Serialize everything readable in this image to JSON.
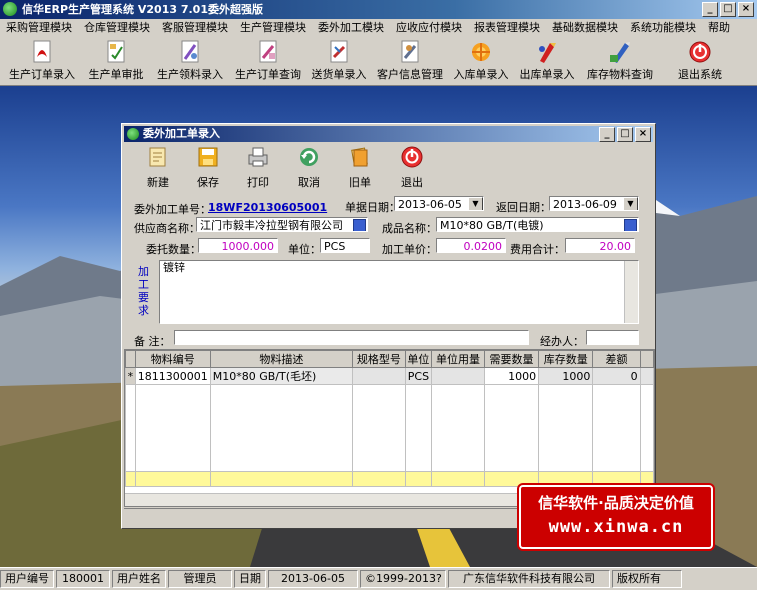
{
  "app": {
    "title": "信华ERP生产管理系统  V2013  7.01委外超强版"
  },
  "menu": [
    "采购管理模块",
    "仓库管理模块",
    "客服管理模块",
    "生产管理模块",
    "委外加工模块",
    "应收应付模块",
    "报表管理模块",
    "基础数据模块",
    "系统功能模块",
    "帮助"
  ],
  "toolbar": [
    {
      "label": "生产订单录入",
      "icon": "pdf-doc-icon"
    },
    {
      "label": "生产单审批",
      "icon": "approve-doc-icon"
    },
    {
      "label": "生产领料录入",
      "icon": "material-doc-icon"
    },
    {
      "label": "生产订单查询",
      "icon": "query-doc-icon"
    },
    {
      "label": "送货单录入",
      "icon": "delivery-doc-icon"
    },
    {
      "label": "客户信息管理",
      "icon": "customer-doc-icon"
    },
    {
      "label": "入库单录入",
      "icon": "stock-in-icon"
    },
    {
      "label": "出库单录入",
      "icon": "stock-out-icon"
    },
    {
      "label": "库存物料查询",
      "icon": "inventory-icon"
    },
    {
      "label": "退出系统",
      "icon": "power-icon"
    }
  ],
  "child": {
    "title": "委外加工单录入",
    "buttons": [
      {
        "label": "新建",
        "icon": "new-doc-icon"
      },
      {
        "label": "保存",
        "icon": "floppy-icon"
      },
      {
        "label": "打印",
        "icon": "printer-icon"
      },
      {
        "label": "取消",
        "icon": "undo-icon"
      },
      {
        "label": "旧单",
        "icon": "old-docs-icon"
      },
      {
        "label": "退出",
        "icon": "power-icon"
      }
    ],
    "form": {
      "order_no_label": "委外加工单号：",
      "order_no": "18WF20130605001",
      "date_label": "单据日期：",
      "date": "2013-06-05",
      "return_label": "返回日期：",
      "return_date": "2013-06-09",
      "supplier_label": "供应商名称：",
      "supplier": "江门市毅丰冷拉型钢有限公司",
      "product_label": "成品名称：",
      "product": "M10*80 GB/T(电镀)",
      "qty_label": "委托数量：",
      "qty": "1000.000",
      "unit_label": "单位：",
      "unit": "PCS",
      "price_label": "加工单价：",
      "price": "0.0200",
      "total_label": "费用合计：",
      "total": "20.00",
      "req_label": "加工要求",
      "req": "镀锌",
      "remark_label": "备  注：",
      "remark": "",
      "handler_label": "经办人：",
      "handler": ""
    },
    "grid": {
      "headers": [
        "物料编号",
        "物料描述",
        "规格型号",
        "单位",
        "单位用量",
        "需要数量",
        "库存数量",
        "差额"
      ],
      "rows": [
        [
          "1811300001",
          "M10*80 GB/T(毛坯)",
          "",
          "PCS",
          "",
          "1000",
          "1000",
          "0"
        ]
      ]
    }
  },
  "watermark": {
    "line1": "信华软件·品质决定价值",
    "line2": "www.xinwa.cn"
  },
  "status": {
    "user_no_label": "用户编号",
    "user_no": "180001",
    "user_name_label": "用户姓名",
    "user_name": "管理员",
    "date_label": "日期",
    "date": "2013-06-05",
    "copyright": "©1999-2013?",
    "company": "广东信华软件科技有限公司",
    "rights": "版权所有"
  },
  "colors": {
    "title_start": "#0a246a",
    "title_end": "#a6caf0",
    "accent_magenta": "#c000c0",
    "link_blue": "#0000c0",
    "total_row": "#fff99a",
    "watermark_red": "#cc0000"
  }
}
